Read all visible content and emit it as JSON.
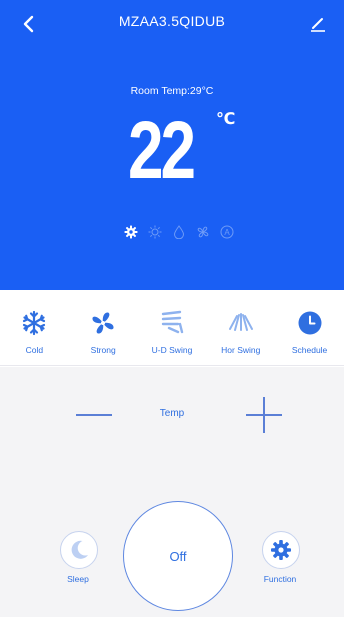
{
  "colors": {
    "header_bg": "#1a5ff4",
    "accent": "#2f6fe0",
    "bottom_bg": "#f4f4f6"
  },
  "header": {
    "back_icon": "chevron-left-icon",
    "title": "MZAA3.5QIDUB",
    "edit_icon": "pencil-icon",
    "room_temp": "Room Temp:29°C",
    "set_temp": "22",
    "temp_unit": "℃",
    "mode_icons": [
      "gear-icon",
      "sun-icon",
      "drop-icon",
      "fan-icon",
      "auto-icon"
    ]
  },
  "controls": [
    {
      "label": "Cold",
      "icon": "snowflake-icon"
    },
    {
      "label": "Strong",
      "icon": "fan-icon"
    },
    {
      "label": "U-D Swing",
      "icon": "vertical-swing-icon"
    },
    {
      "label": "Hor Swing",
      "icon": "horizontal-swing-icon"
    },
    {
      "label": "Schedule",
      "icon": "clock-icon"
    }
  ],
  "temp_control": {
    "label": "Temp"
  },
  "sleep": {
    "label": "Sleep",
    "icon": "moon-icon"
  },
  "power": {
    "label": "Off"
  },
  "function": {
    "label": "Function",
    "icon": "gear-icon"
  }
}
